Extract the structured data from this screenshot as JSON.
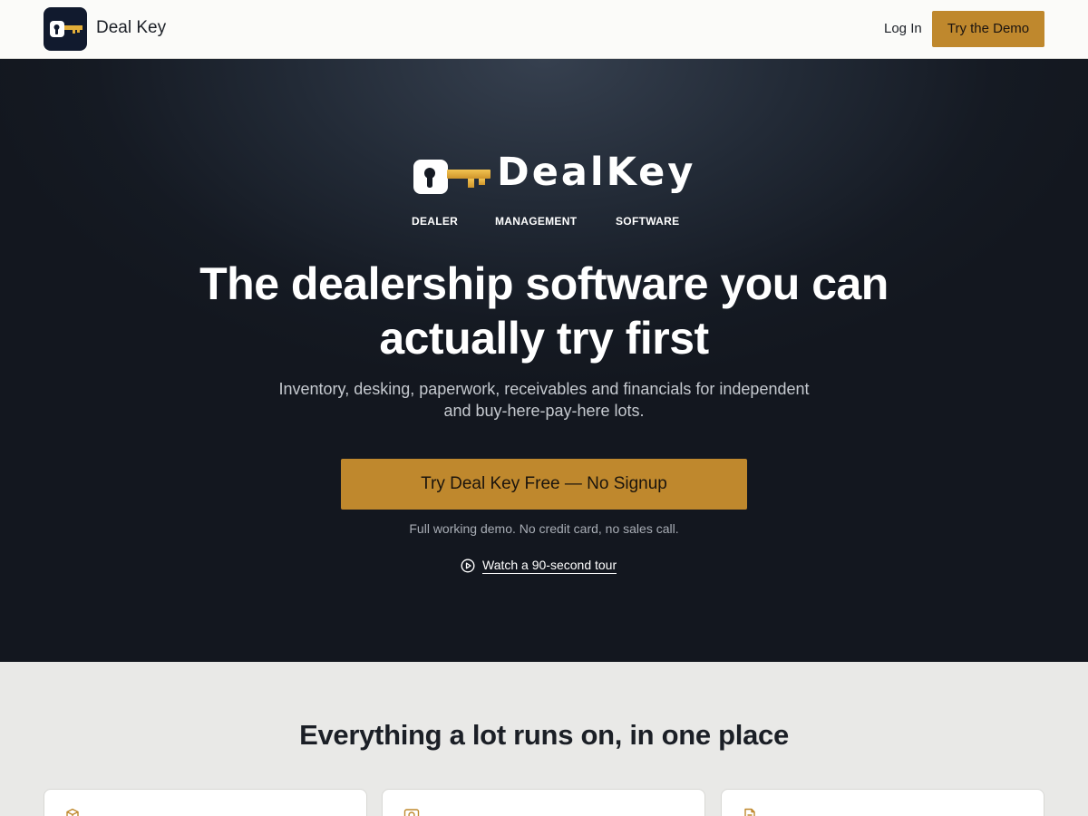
{
  "nav": {
    "brand": "Deal Key",
    "login_label": "Log In",
    "demo_label": "Try the Demo",
    "logo_icon": "key-icon"
  },
  "hero": {
    "wordmark": "DealKey",
    "tagline": [
      "DEALER",
      "MANAGEMENT",
      "SOFTWARE"
    ],
    "headline": "The dealership software you can actually try first",
    "subheadline": "Inventory, desking, paperwork, receivables and financials for independent and buy-here-pay-here lots.",
    "cta_label": "Try Deal Key Free — No Signup",
    "note": "Full working demo. No credit card, no sales call.",
    "tour_label": "Watch a 90-second tour",
    "tour_icon": "play-circle-icon"
  },
  "features": {
    "title": "Everything a lot runs on, in one place",
    "card_icons": [
      "box-icon",
      "dollar-badge-icon",
      "document-icon"
    ]
  },
  "colors": {
    "accent": "#bf882d",
    "key_gold": "#e2ad38",
    "hero_dark": "#151a23",
    "logo_bg": "#111a2e",
    "section_bg": "#e9e9e7"
  }
}
